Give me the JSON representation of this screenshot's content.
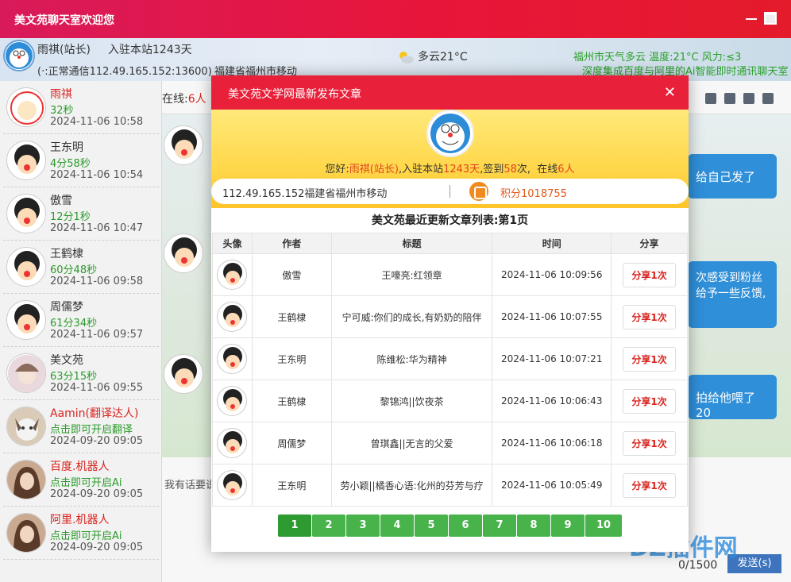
{
  "window": {
    "title": "美文苑聊天室欢迎您"
  },
  "banner": {
    "user_name": "雨祺(站长)",
    "joined": "入驻本站1243天",
    "connection": "(·:正常通信112.49.165.152:13600)",
    "location": "福建省福州市移动",
    "weather": "多云21°C",
    "weather_detail": "福州市天气多云 温度:21°C 风力:≤3",
    "ai_notice": "深度集成百度与阿里的Ai智能即时通讯聊天室"
  },
  "users": [
    {
      "name": "雨祺",
      "duration": "32秒",
      "time": "2024-11-06 10:58"
    },
    {
      "name": "王东明",
      "duration": "4分58秒",
      "time": "2024-11-06 10:54"
    },
    {
      "name": "傲雪",
      "duration": "12分1秒",
      "time": "2024-11-06 10:47"
    },
    {
      "name": "王鹤棣",
      "duration": "60分48秒",
      "time": "2024-11-06 09:58"
    },
    {
      "name": "周儒梦",
      "duration": "61分34秒",
      "time": "2024-11-06 09:57"
    },
    {
      "name": "美文苑",
      "duration": "63分15秒",
      "time": "2024-11-06 09:55"
    },
    {
      "name": "Aamin(翻译达人)",
      "duration": "点击即可开启翻译",
      "time": "2024-09-20 09:05"
    },
    {
      "name": "百度.机器人",
      "duration": "点击即可开启Ai",
      "time": "2024-09-20 09:05"
    },
    {
      "name": "阿里.机器人",
      "duration": "点击即可开启Ai",
      "time": "2024-09-20 09:05"
    }
  ],
  "chat": {
    "online_label": "在线:",
    "online_count": "6人",
    "messages": [
      "给自己发了",
      "次感受到粉丝\n给予一些反馈,",
      "拍给他喂了20"
    ],
    "input_placeholder": "我有话要说",
    "counter": "0/1500",
    "send": "发送(s)"
  },
  "modal": {
    "title": "美文苑文学网最新发布文章",
    "close": "✕",
    "greeting": {
      "hello": "您好:",
      "name": "雨祺(站长)",
      "mid1": ",入驻本站",
      "days": "1243天",
      "mid2": ",签到",
      "signins": "58",
      "mid3": "次,",
      "online_label": "在线",
      "online": "6人"
    },
    "ip": "112.49.165.152福建省福州市移动",
    "score": "积分1018755",
    "list_title": "美文苑最近更新文章列表:第1页",
    "columns": [
      "头像",
      "作者",
      "标题",
      "时间",
      "分享"
    ],
    "rows": [
      {
        "author": "傲雪",
        "title": "王嚎亮:红领章",
        "time": "2024-11-06 10:09:56",
        "share": "分享1次"
      },
      {
        "author": "王鹤棣",
        "title": "宁可威:你们的成长,有奶奶的陪伴",
        "time": "2024-11-06 10:07:55",
        "share": "分享1次"
      },
      {
        "author": "王东明",
        "title": "陈维松:华为精神",
        "time": "2024-11-06 10:07:21",
        "share": "分享1次"
      },
      {
        "author": "王鹤棣",
        "title": "黎锦鸿||饮夜茶",
        "time": "2024-11-06 10:06:43",
        "share": "分享1次"
      },
      {
        "author": "周儒梦",
        "title": "曾琪鑫||无言的父爱",
        "time": "2024-11-06 10:06:18",
        "share": "分享1次"
      },
      {
        "author": "王东明",
        "title": "劳小颖||橘香心语:化州的芬芳与疗",
        "time": "2024-11-06 10:05:49",
        "share": "分享1次"
      }
    ],
    "pages": [
      "1",
      "2",
      "3",
      "4",
      "5",
      "6",
      "7",
      "8",
      "9",
      "10"
    ]
  },
  "watermark": "DZ插件网",
  "colors": {
    "titlebar": "#e8153a",
    "accent_green": "#47b34a",
    "modal_header": "#e8203a",
    "highlight": "#e0441f"
  }
}
